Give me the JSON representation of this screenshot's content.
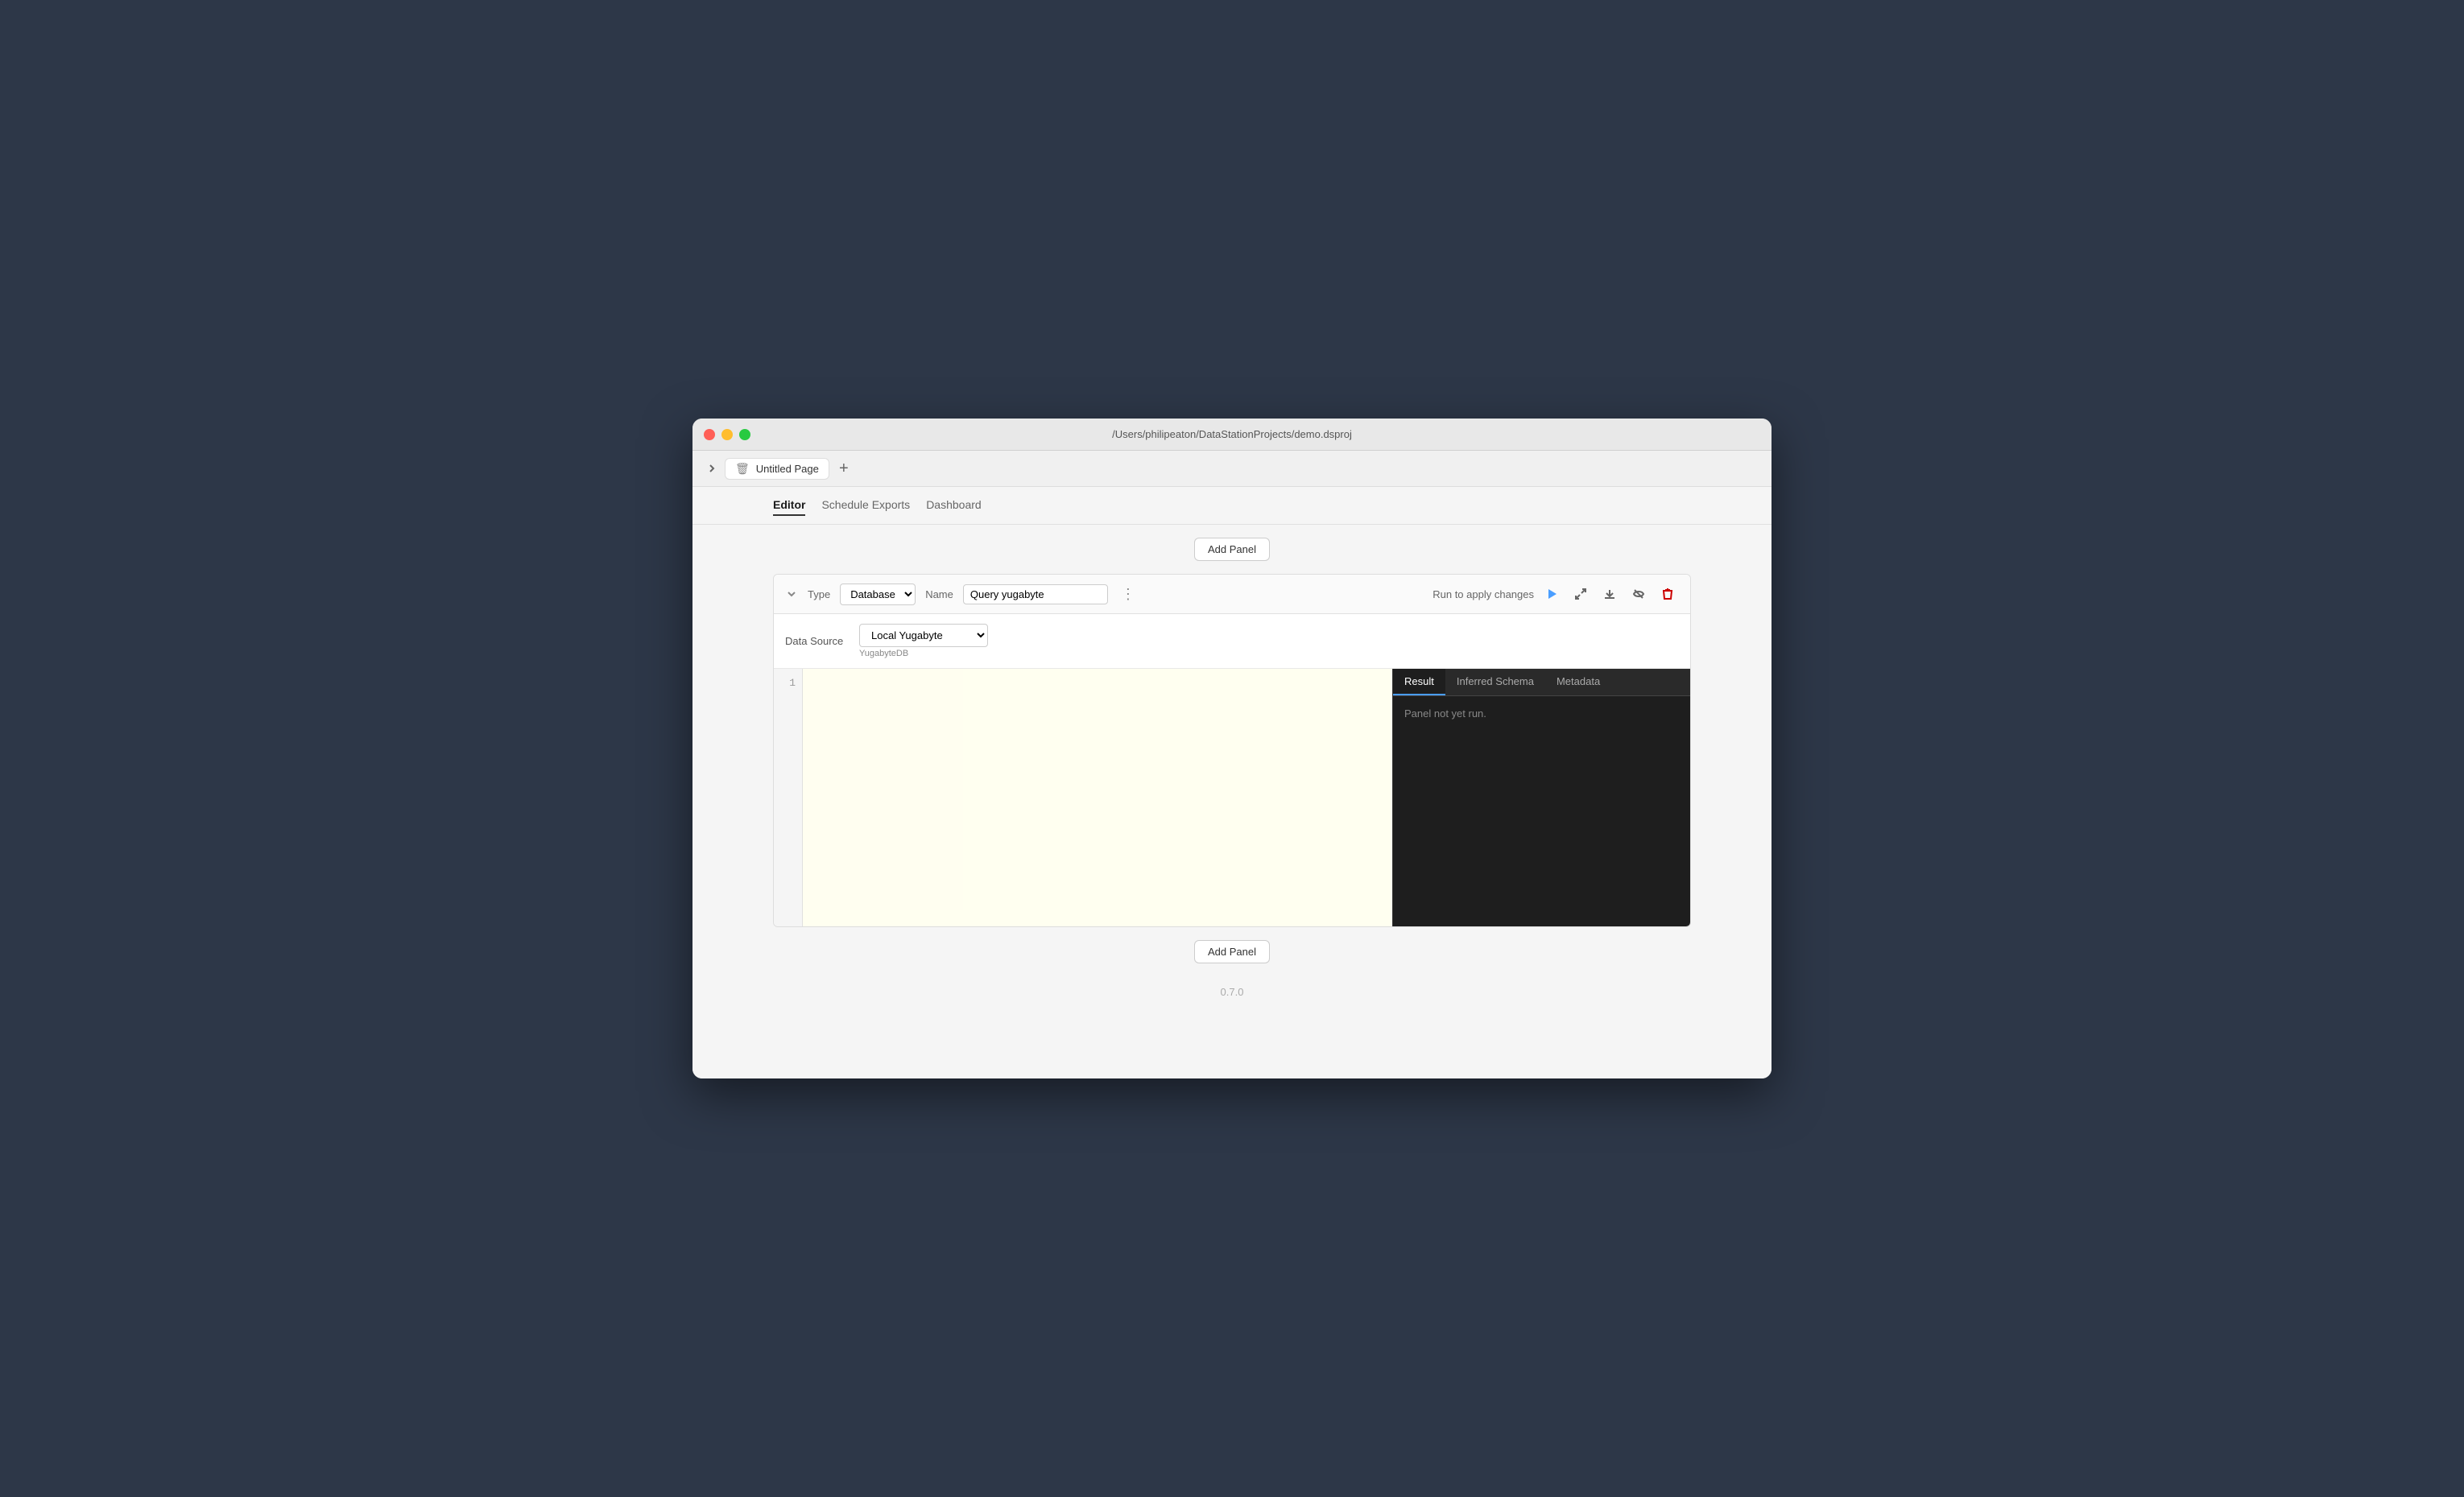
{
  "window": {
    "titlebar_path": "/Users/philipeaton/DataStationProjects/demo.dsproj"
  },
  "tabs": {
    "page_name": "Untitled Page",
    "add_label": "+"
  },
  "nav": {
    "items": [
      {
        "label": "Editor",
        "active": true
      },
      {
        "label": "Schedule Exports",
        "active": false
      },
      {
        "label": "Dashboard",
        "active": false
      }
    ]
  },
  "toolbar": {
    "add_panel_top": "Add Panel",
    "add_panel_bottom": "Add Panel"
  },
  "panel": {
    "type_label": "Type",
    "type_value": "Database",
    "name_label": "Name",
    "name_value": "Query yugabyte",
    "run_label": "Run to apply changes",
    "datasource_label": "Data Source",
    "datasource_value": "Local Yugabyte",
    "datasource_sub": "YugabyteDB",
    "line_number": "1",
    "result_tabs": [
      {
        "label": "Result",
        "active": true
      },
      {
        "label": "Inferred Schema",
        "active": false
      },
      {
        "label": "Metadata",
        "active": false
      }
    ],
    "result_empty": "Panel not yet run."
  },
  "footer": {
    "version": "0.7.0"
  },
  "icons": {
    "chevron_right": "❯",
    "chevron_down": "⌄",
    "trash": "🗑",
    "plus": "+",
    "more": "⋮",
    "play": "▷",
    "expand": "⤢",
    "download": "⬇",
    "hide": "⊘",
    "delete": "✕"
  }
}
